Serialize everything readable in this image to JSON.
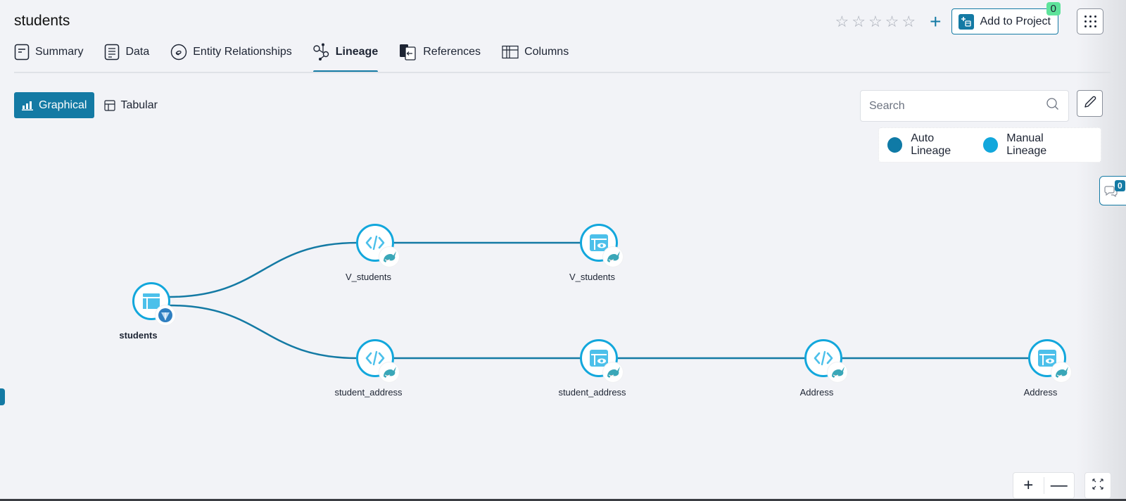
{
  "page": {
    "title": "students"
  },
  "header": {
    "rating": {
      "max": 5,
      "value": 0
    },
    "add_rating_icon": "plus-icon",
    "add_to_project": {
      "label": "Add to Project",
      "badge": "0"
    },
    "apps_menu_icon": "grid-dots-icon"
  },
  "tabs": [
    {
      "label": "Summary",
      "icon": "document-icon",
      "active": false
    },
    {
      "label": "Data",
      "icon": "list-document-icon",
      "active": false
    },
    {
      "label": "Entity Relationships",
      "icon": "link-circle-icon",
      "active": false
    },
    {
      "label": "Lineage",
      "icon": "lineage-icon",
      "active": true
    },
    {
      "label": "References",
      "icon": "references-icon",
      "active": false
    },
    {
      "label": "Columns",
      "icon": "columns-icon",
      "active": false
    }
  ],
  "view_toggle": {
    "graphical": {
      "label": "Graphical",
      "active": true
    },
    "tabular": {
      "label": "Tabular",
      "active": false
    }
  },
  "search": {
    "placeholder": "Search",
    "value": ""
  },
  "legend": {
    "items": [
      {
        "label": "Auto Lineage",
        "color": "#0f7aa6"
      },
      {
        "label": "Manual Lineage",
        "color": "#12a7dc"
      }
    ]
  },
  "comments": {
    "count": "0"
  },
  "colors": {
    "accent": "#147aa4",
    "node_border": "#12a7dc",
    "node_icon": "#4cc0ea",
    "edge": "#147aa4",
    "badge_green": "#5ee39b"
  },
  "lineage": {
    "nodes": [
      {
        "id": "n0",
        "label": "students",
        "type": "table",
        "source": "database-source-icon",
        "root": true
      },
      {
        "id": "n1",
        "label": "V_students",
        "type": "code",
        "source": "narwhal-source-icon"
      },
      {
        "id": "n2",
        "label": "V_students",
        "type": "view",
        "source": "narwhal-source-icon"
      },
      {
        "id": "n3",
        "label": "student_address",
        "type": "code",
        "source": "narwhal-source-icon"
      },
      {
        "id": "n4",
        "label": "student_address",
        "type": "view",
        "source": "narwhal-source-icon"
      },
      {
        "id": "n5",
        "label": "Address",
        "type": "code",
        "source": "narwhal-source-icon"
      },
      {
        "id": "n6",
        "label": "Address",
        "type": "view",
        "source": "narwhal-source-icon"
      }
    ],
    "edges": [
      {
        "from": "n0",
        "to": "n1",
        "kind": "auto"
      },
      {
        "from": "n1",
        "to": "n2",
        "kind": "auto"
      },
      {
        "from": "n0",
        "to": "n3",
        "kind": "auto"
      },
      {
        "from": "n3",
        "to": "n4",
        "kind": "auto"
      },
      {
        "from": "n4",
        "to": "n5",
        "kind": "auto"
      },
      {
        "from": "n5",
        "to": "n6",
        "kind": "auto"
      }
    ]
  },
  "canvas_controls": {
    "zoom_in": "+",
    "zoom_out": "—",
    "fit_icon": "fullscreen-icon"
  }
}
